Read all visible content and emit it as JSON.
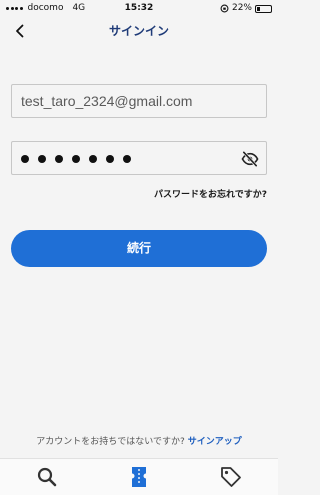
{
  "status": {
    "carrier": "docomo",
    "network": "4G",
    "time": "15:32",
    "battery": "22%",
    "battery_level": 0.22
  },
  "header": {
    "title": "サインイン",
    "back_icon": "chevron-left-icon"
  },
  "form": {
    "email_value": "test_taro_2324@gmail.com",
    "password_masked_length": 7,
    "visibility_icon": "eye-slash-icon",
    "forgot_password_label": "パスワードをお忘れですか?",
    "continue_label": "続行"
  },
  "signup": {
    "prompt": "アカウントをお持ちではないですか?",
    "link_label": "サインアップ"
  },
  "tab_bar": {
    "tabs": [
      {
        "icon": "search-icon"
      },
      {
        "icon": "ticket-icon"
      },
      {
        "icon": "tag-icon"
      }
    ]
  },
  "colors": {
    "accent": "#1f6fd6",
    "title": "#1f3b78",
    "link": "#1f5fbf",
    "background": "#f4f4f4"
  }
}
